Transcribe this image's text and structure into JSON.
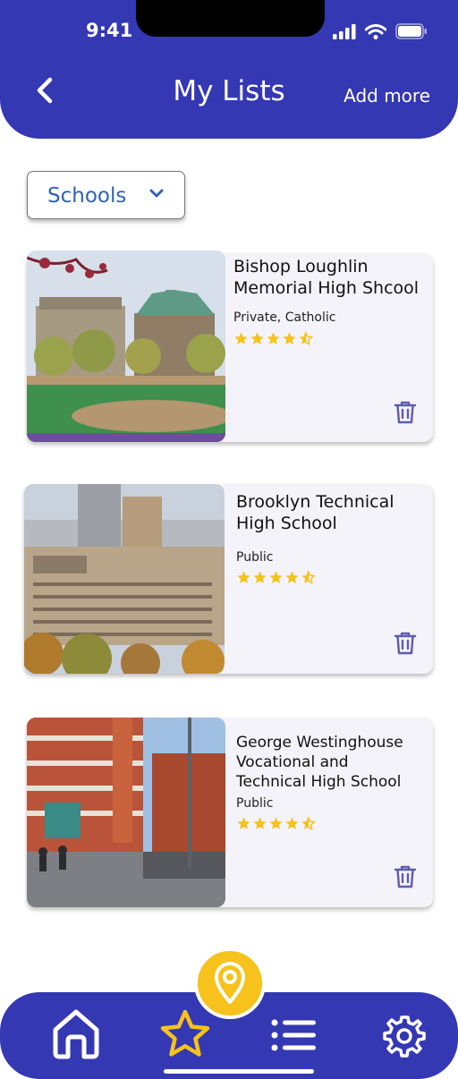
{
  "status_bar": {
    "time": "9:41"
  },
  "header": {
    "title": "My Lists",
    "add_more": "Add more"
  },
  "filter": {
    "selected": "Schools"
  },
  "schools": [
    {
      "name_line1": "Bishop Loughlin",
      "name_line2": "Memorial High Shcool",
      "type": "Private, Catholic",
      "rating": 4.5
    },
    {
      "name_line1": "Brooklyn Technical",
      "name_line2": "High School",
      "type": "Public",
      "rating": 4.5
    },
    {
      "name_line1": "George Westinghouse",
      "name_line2": "Vocational and",
      "name_line3": "Technical High School",
      "type": "Public",
      "rating": 4.5
    }
  ],
  "nav": {
    "items": [
      "home-icon",
      "star-icon",
      "list-icon",
      "gear-icon"
    ],
    "center": "map-pin-icon",
    "active": "star-icon"
  },
  "colors": {
    "brand": "#3538b3",
    "accent": "#f6c21b",
    "card_bg": "#f4f3f9",
    "icon": "#5e5cae"
  }
}
